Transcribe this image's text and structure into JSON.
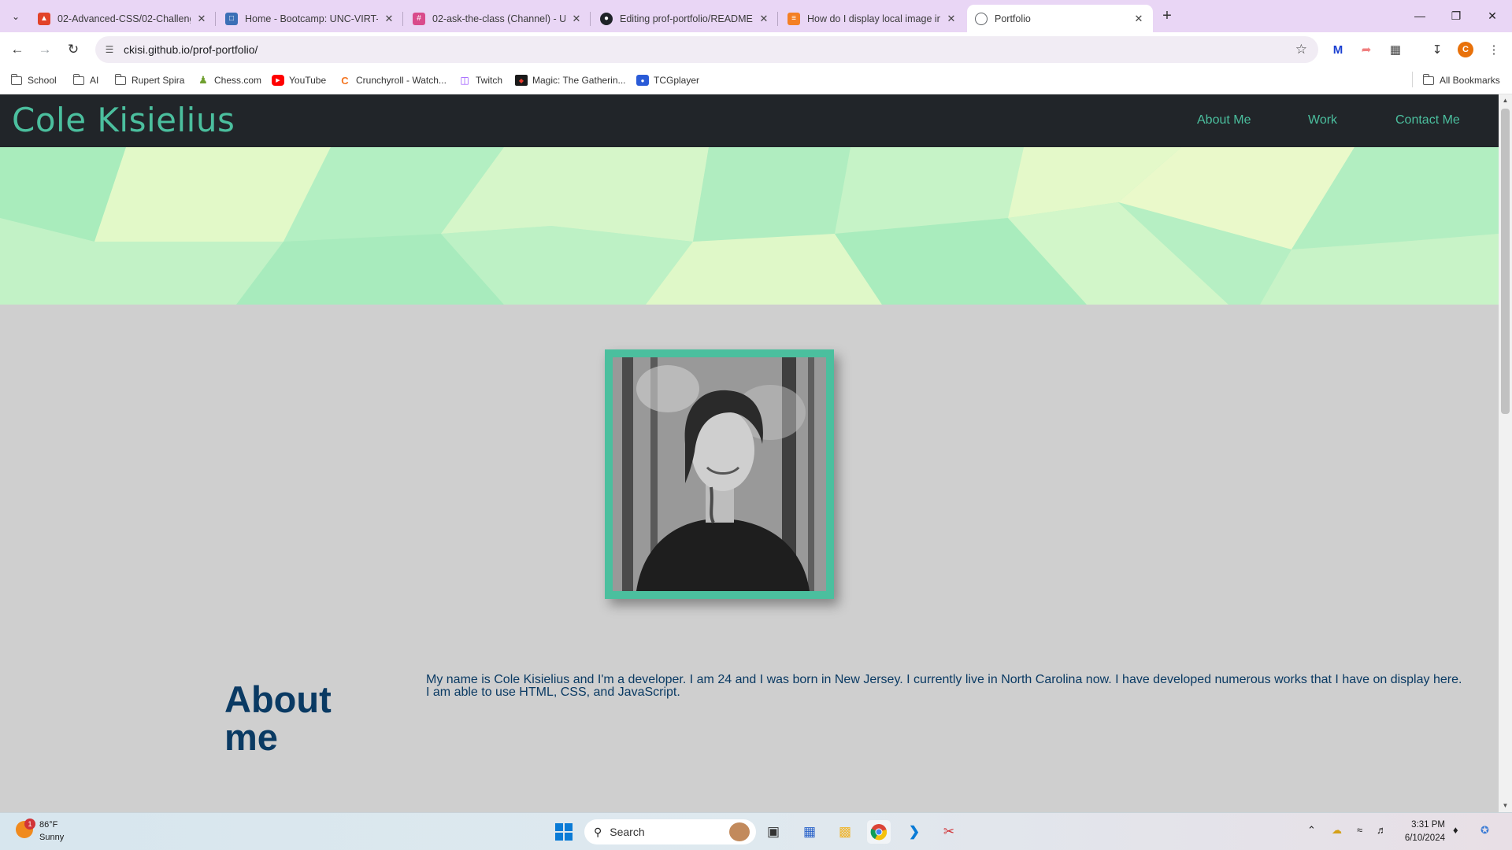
{
  "browser": {
    "tabs": [
      {
        "title": "02-Advanced-CSS/02-Challeng",
        "icon": "gitlab-icon",
        "color": "#e24329"
      },
      {
        "title": "Home - Bootcamp: UNC-VIRT-F",
        "icon": "canvas-icon",
        "color": "#3b6fb6"
      },
      {
        "title": "02-ask-the-class (Channel) - UN",
        "icon": "slack-icon",
        "color": "#d94b8b"
      },
      {
        "title": "Editing prof-portfolio/README",
        "icon": "github-icon",
        "color": "#1f2328"
      },
      {
        "title": "How do I display local image in",
        "icon": "stackoverflow-icon",
        "color": "#f48024"
      },
      {
        "title": "Portfolio",
        "icon": "globe-icon",
        "color": "#5f6368"
      }
    ],
    "url": "ckisi.github.io/prof-portfolio/",
    "profile_initial": "C",
    "bookmarks": [
      {
        "label": "School",
        "icon": "folder-icon"
      },
      {
        "label": "AI",
        "icon": "folder-icon"
      },
      {
        "label": "Rupert Spira",
        "icon": "folder-icon"
      },
      {
        "label": "Chess.com",
        "icon": "chess-icon"
      },
      {
        "label": "YouTube",
        "icon": "youtube-icon"
      },
      {
        "label": "Crunchyroll - Watch...",
        "icon": "crunchyroll-icon"
      },
      {
        "label": "Twitch",
        "icon": "twitch-icon"
      },
      {
        "label": "Magic: The Gatherin...",
        "icon": "mtg-icon"
      },
      {
        "label": "TCGplayer",
        "icon": "tcgplayer-icon"
      }
    ],
    "all_bookmarks": "All Bookmarks"
  },
  "page": {
    "site_name": "Cole Kisielius",
    "nav": [
      "About Me",
      "Work",
      "Contact Me"
    ],
    "accent_color": "#4bbf9e",
    "header_color": "#212529",
    "about_title": "About me",
    "about_text": "My name is Cole Kisielius and I'm a developer. I am 24 and I was born in New Jersey. I currently live in North Carolina now. I have developed numerous works that I have on display here. I am able to use HTML, CSS, and JavaScript."
  },
  "taskbar": {
    "weather_temp": "86°F",
    "weather_condition": "Sunny",
    "weather_badge": "1",
    "search_placeholder": "Search",
    "time": "3:31 PM",
    "date": "6/10/2024"
  }
}
